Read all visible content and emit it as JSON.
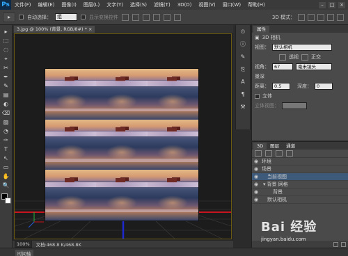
{
  "menubar": {
    "logo": "Ps",
    "items": [
      "文件(F)",
      "编辑(E)",
      "图像(I)",
      "图层(L)",
      "文字(Y)",
      "选择(S)",
      "滤镜(T)",
      "3D(D)",
      "视图(V)",
      "窗口(W)",
      "帮助(H)"
    ],
    "controls": [
      "–",
      "□",
      "×"
    ]
  },
  "options": {
    "auto_select_label": "自动选择：",
    "auto_select_value": "组",
    "transform_label": "显示变换控件",
    "mode3d_label": "3D 模式："
  },
  "toolbar": {
    "tools": [
      "▸",
      "⬚",
      "◌",
      "⌖",
      "✂",
      "✒",
      "✎",
      "▤",
      "◐",
      "⌫",
      "▨",
      "◔",
      "✑",
      "T",
      "↖",
      "▭",
      "✋",
      "🔍"
    ]
  },
  "document": {
    "tab_title": "3.jpg @ 100% (背景, RGB/8#) *",
    "tab_close": "×",
    "zoom": "100%",
    "doc_size": "文档:468.8 K/468.8K"
  },
  "timeline": {
    "label": "时间轴"
  },
  "properties": {
    "tab": "属性",
    "header": "3D 相机",
    "view_label": "视图：",
    "view_value": "默认相机",
    "perspective": "透视",
    "orthographic": "正交",
    "fov_label": "视角：",
    "fov_value": "67",
    "fov_unit": "毫米镜头",
    "dof_label": "景深",
    "distance_label": "距离：",
    "distance_value": "0.5",
    "depth_label": "深度：",
    "depth_value": "0",
    "stereo_label": "立体",
    "stereo_type_label": "立体视图："
  },
  "layers": {
    "tabs": [
      "3D",
      "图层",
      "通道"
    ],
    "rows": [
      {
        "name": "环境",
        "indent": 0,
        "selected": false
      },
      {
        "name": "场景",
        "indent": 0,
        "selected": false
      },
      {
        "name": "当前视图",
        "indent": 1,
        "selected": true
      },
      {
        "name": "背景 网格",
        "indent": 1,
        "selected": false
      },
      {
        "name": "背景",
        "indent": 2,
        "selected": false
      },
      {
        "name": "默认相机",
        "indent": 1,
        "selected": false
      }
    ]
  },
  "watermark": {
    "main": "Bai 经验",
    "sub": "jingyan.baidu.com"
  }
}
